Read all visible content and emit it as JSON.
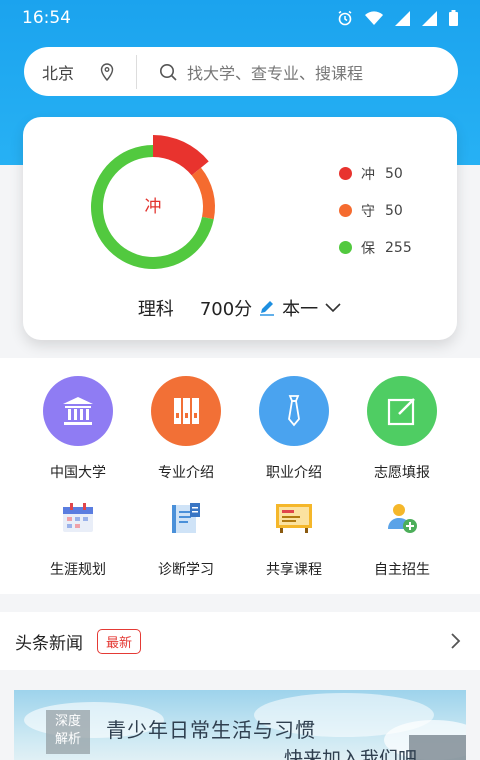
{
  "status": {
    "time": "16:54"
  },
  "search": {
    "city": "北京",
    "placeholder": "找大学、查专业、搜课程"
  },
  "card": {
    "center_label": "冲",
    "legend": [
      {
        "name": "冲",
        "value": "50",
        "color": "#e8332e"
      },
      {
        "name": "守",
        "value": "50",
        "color": "#f56b2f"
      },
      {
        "name": "保",
        "value": "255",
        "color": "#52c93f"
      }
    ],
    "subject": "理科",
    "score": "700分",
    "batch": "本一"
  },
  "chart_data": {
    "type": "pie",
    "categories": [
      "冲",
      "守",
      "保"
    ],
    "values": [
      50,
      50,
      255
    ],
    "center_label": "冲"
  },
  "grid": [
    {
      "label": "中国大学",
      "icon": "university-icon",
      "color": "#8f7cf3"
    },
    {
      "label": "专业介绍",
      "icon": "books-icon",
      "color": "#f27036"
    },
    {
      "label": "职业介绍",
      "icon": "necktie-icon",
      "color": "#4aa3ef"
    },
    {
      "label": "志愿填报",
      "icon": "edit-form-icon",
      "color": "#4fcd63"
    },
    {
      "label": "生涯规划",
      "icon": "calendar-icon",
      "color": "#5a7de0"
    },
    {
      "label": "诊断学习",
      "icon": "report-book-icon",
      "color": "#4a90d9"
    },
    {
      "label": "共享课程",
      "icon": "blackboard-icon",
      "color": "#f5b72a"
    },
    {
      "label": "自主招生",
      "icon": "add-user-icon",
      "color": "#4cae5a"
    }
  ],
  "news": {
    "title": "头条新闻",
    "badge": "最新"
  },
  "banner": {
    "tag_line1": "深度",
    "tag_line2": "解析",
    "title": "青少年日常生活与习惯",
    "subtitle": "快来加入我们吧"
  }
}
